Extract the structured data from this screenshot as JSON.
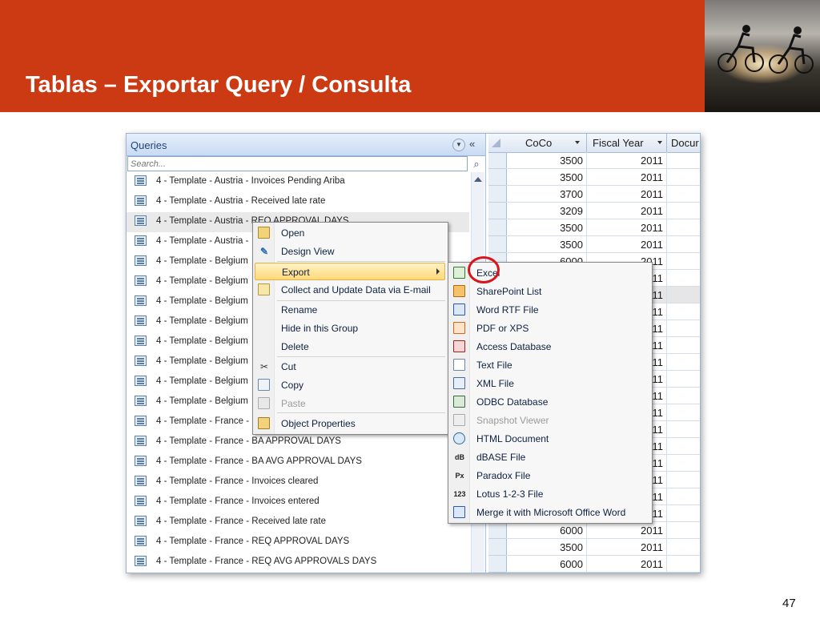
{
  "slide": {
    "title": "Tablas – Exportar Query / Consulta",
    "page_number": "47"
  },
  "colors": {
    "banner": "#cc3a14",
    "menu_highlight": "#ffd878",
    "annotation_circle": "#d8141c",
    "nav_header": "#c8daf3"
  },
  "nav": {
    "title": "Queries",
    "search_placeholder": "Search...",
    "items": [
      "4 - Template - Austria - Invoices Pending Ariba",
      "4 - Template - Austria - Received late rate",
      "4 - Template - Austria - REQ APPROVAL DAYS",
      "4 - Template - Austria - ",
      "4 - Template - Belgium",
      "4 - Template - Belgium",
      "4 - Template - Belgium",
      "4 - Template - Belgium",
      "4 - Template - Belgium",
      "4 - Template - Belgium",
      "4 - Template - Belgium",
      "4 - Template - Belgium",
      "4 - Template - France - ",
      "4 - Template - France - BA APPROVAL DAYS",
      "4 - Template - France - BA AVG APPROVAL DAYS",
      "4 - Template - France - Invoices cleared",
      "4 - Template - France - Invoices entered",
      "4 - Template - France - Received late rate",
      "4 - Template - France - REQ APPROVAL DAYS",
      "4 - Template - France - REQ AVG APPROVALS DAYS"
    ]
  },
  "grid": {
    "columns": [
      "CoCo",
      "Fiscal Year",
      "Docur"
    ],
    "rows": [
      {
        "coco": "3500",
        "year": "2011"
      },
      {
        "coco": "3500",
        "year": "2011"
      },
      {
        "coco": "3700",
        "year": "2011"
      },
      {
        "coco": "3209",
        "year": "2011"
      },
      {
        "coco": "3500",
        "year": "2011"
      },
      {
        "coco": "3500",
        "year": "2011"
      },
      {
        "coco": "6000",
        "year": "2011"
      },
      {
        "coco": "",
        "year": "2011"
      },
      {
        "coco": "",
        "year": "2011"
      },
      {
        "coco": "",
        "year": "2011"
      },
      {
        "coco": "",
        "year": "2011"
      },
      {
        "coco": "",
        "year": "2011"
      },
      {
        "coco": "",
        "year": "2011"
      },
      {
        "coco": "",
        "year": "2011"
      },
      {
        "coco": "",
        "year": "2011"
      },
      {
        "coco": "",
        "year": "2011"
      },
      {
        "coco": "",
        "year": "2011"
      },
      {
        "coco": "",
        "year": "2011"
      },
      {
        "coco": "",
        "year": "2011"
      },
      {
        "coco": "",
        "year": "2011"
      },
      {
        "coco": "",
        "year": "2011"
      },
      {
        "coco": "",
        "year": "2011"
      },
      {
        "coco": "6000",
        "year": "2011"
      },
      {
        "coco": "3500",
        "year": "2011"
      },
      {
        "coco": "6000",
        "year": "2011"
      }
    ]
  },
  "context_menu": {
    "items": [
      {
        "label": "Open",
        "icon": "open-icon"
      },
      {
        "label": "Design View",
        "icon": "design-view-icon"
      },
      {
        "label": "Export",
        "icon": "export-icon"
      },
      {
        "label": "Collect and Update Data via E-mail",
        "icon": "email-data-icon"
      },
      {
        "label": "Rename",
        "icon": ""
      },
      {
        "label": "Hide in this Group",
        "icon": ""
      },
      {
        "label": "Delete",
        "icon": ""
      },
      {
        "label": "Cut",
        "icon": "scissors-icon"
      },
      {
        "label": "Copy",
        "icon": "copy-icon"
      },
      {
        "label": "Paste",
        "icon": "paste-icon"
      },
      {
        "label": "Object Properties",
        "icon": "properties-icon"
      }
    ]
  },
  "export_menu": {
    "items": [
      {
        "label": "Excel",
        "icon": "excel-icon"
      },
      {
        "label": "SharePoint List",
        "icon": "sharepoint-icon"
      },
      {
        "label": "Word RTF File",
        "icon": "word-rtf-icon"
      },
      {
        "label": "PDF or XPS",
        "icon": "pdf-xps-icon"
      },
      {
        "label": "Access Database",
        "icon": "access-icon"
      },
      {
        "label": "Text File",
        "icon": "text-file-icon"
      },
      {
        "label": "XML File",
        "icon": "xml-icon"
      },
      {
        "label": "ODBC Database",
        "icon": "odbc-icon"
      },
      {
        "label": "Snapshot Viewer",
        "icon": "snapshot-icon"
      },
      {
        "label": "HTML Document",
        "icon": "html-icon"
      },
      {
        "label": "dBASE File",
        "icon": "dbase-icon",
        "glyph": "dB"
      },
      {
        "label": "Paradox File",
        "icon": "paradox-icon",
        "glyph": "Px"
      },
      {
        "label": "Lotus 1-2-3 File",
        "icon": "lotus-icon",
        "glyph": "123"
      },
      {
        "label": "Merge it with Microsoft Office Word",
        "icon": "word-merge-icon"
      }
    ]
  }
}
